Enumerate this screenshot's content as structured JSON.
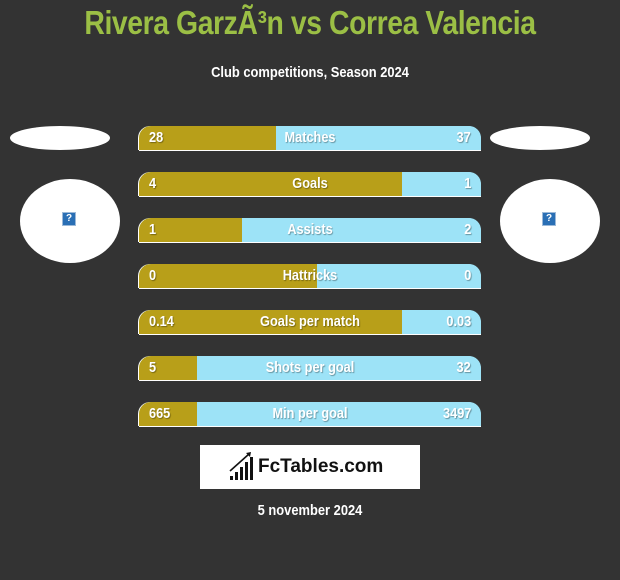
{
  "header": {
    "title": "Rivera GarzÃ³n vs Correa Valencia",
    "subtitle": "Club competitions, Season 2024"
  },
  "players": {
    "left": {
      "logo_icon": "missing-image-icon",
      "logo_glyph": "?"
    },
    "right": {
      "logo_icon": "missing-image-icon",
      "logo_glyph": "?"
    }
  },
  "colors": {
    "left_bar": "#b89f19",
    "right_bar": "#9de3f7",
    "title": "#9bbf45",
    "background": "#333333"
  },
  "stats": [
    {
      "label": "Matches",
      "left": "28",
      "right": "37",
      "left_share": 0.4
    },
    {
      "label": "Goals",
      "left": "4",
      "right": "1",
      "left_share": 0.77
    },
    {
      "label": "Assists",
      "left": "1",
      "right": "2",
      "left_share": 0.3
    },
    {
      "label": "Hattricks",
      "left": "0",
      "right": "0",
      "left_share": 0.52
    },
    {
      "label": "Goals per match",
      "left": "0.14",
      "right": "0.03",
      "left_share": 0.77
    },
    {
      "label": "Shots per goal",
      "left": "5",
      "right": "32",
      "left_share": 0.17
    },
    {
      "label": "Min per goal",
      "left": "665",
      "right": "3497",
      "left_share": 0.17
    }
  ],
  "footer": {
    "brand": "FcTables.com",
    "brand_icon": "bar-chart-growth-icon",
    "date": "5 november 2024"
  }
}
